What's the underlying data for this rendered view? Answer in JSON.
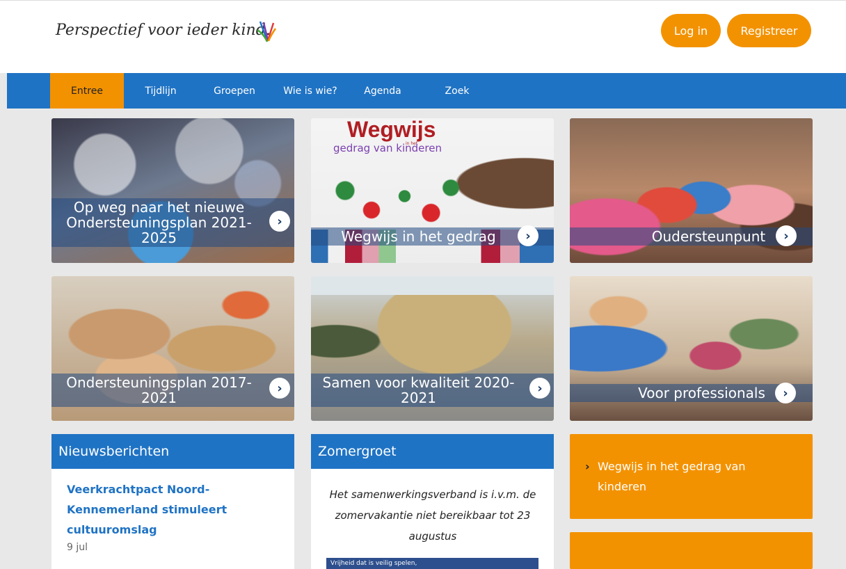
{
  "header": {
    "tagline": "Perspectief voor ieder kind.",
    "login_label": "Log in",
    "register_label": "Registreer"
  },
  "nav": {
    "items": [
      {
        "label": "Entree",
        "active": true
      },
      {
        "label": "Tijdlijn"
      },
      {
        "label": "Groepen"
      },
      {
        "label": "Wie is wie?"
      },
      {
        "label": "Agenda"
      },
      {
        "label": "Zoek"
      }
    ]
  },
  "tiles": [
    {
      "caption": "Op weg naar het nieuwe Ondersteuningsplan 2021-2025"
    },
    {
      "caption": "Wegwijs in het gedrag",
      "image_title": "Wegwijs",
      "image_small": "in het",
      "image_subtitle": "gedrag van kinderen"
    },
    {
      "caption": "Oudersteunpunt"
    },
    {
      "caption": "Ondersteuningsplan 2017-2021"
    },
    {
      "caption": "Samen voor kwaliteit 2020-2021"
    },
    {
      "caption": "Voor professionals"
    }
  ],
  "news": {
    "heading": "Nieuwsberichten",
    "item_title": "Veerkrachtpact Noord-Kennemerland stimuleert cultuuromslag",
    "item_date": "9 jul"
  },
  "summer": {
    "heading": "Zomergroet",
    "text": "Het samenwerkingsverband is i.v.m. de zomervakantie niet bereikbaar tot 23 augustus",
    "image_text": "Vrijheid dat is veilig spelen,"
  },
  "side": {
    "link_label": "Wegwijs in het gedrag van kinderen"
  },
  "colors": {
    "primary_blue": "#1f73c4",
    "accent_orange": "#f39200",
    "background": "#e8e8e8"
  }
}
